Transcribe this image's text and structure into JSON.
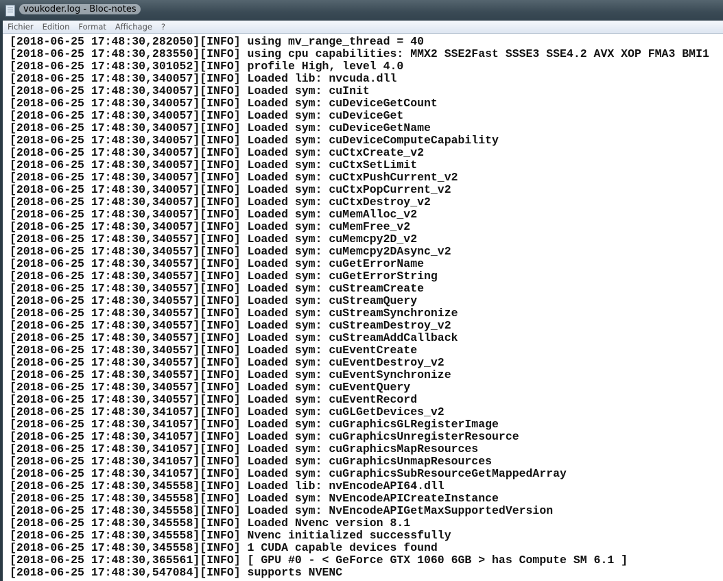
{
  "window": {
    "title": "voukoder.log - Bloc-notes"
  },
  "menu": [
    "Fichier",
    "Edition",
    "Format",
    "Affichage",
    "?"
  ],
  "lines": [
    "[2018-06-25 17:48:30,282050][INFO] using mv_range_thread = 40",
    "[2018-06-25 17:48:30,283550][INFO] using cpu capabilities: MMX2 SSE2Fast SSSE3 SSE4.2 AVX XOP FMA3 BMI1",
    "[2018-06-25 17:48:30,301052][INFO] profile High, level 4.0",
    "[2018-06-25 17:48:30,340057][INFO] Loaded lib: nvcuda.dll",
    "[2018-06-25 17:48:30,340057][INFO] Loaded sym: cuInit",
    "[2018-06-25 17:48:30,340057][INFO] Loaded sym: cuDeviceGetCount",
    "[2018-06-25 17:48:30,340057][INFO] Loaded sym: cuDeviceGet",
    "[2018-06-25 17:48:30,340057][INFO] Loaded sym: cuDeviceGetName",
    "[2018-06-25 17:48:30,340057][INFO] Loaded sym: cuDeviceComputeCapability",
    "[2018-06-25 17:48:30,340057][INFO] Loaded sym: cuCtxCreate_v2",
    "[2018-06-25 17:48:30,340057][INFO] Loaded sym: cuCtxSetLimit",
    "[2018-06-25 17:48:30,340057][INFO] Loaded sym: cuCtxPushCurrent_v2",
    "[2018-06-25 17:48:30,340057][INFO] Loaded sym: cuCtxPopCurrent_v2",
    "[2018-06-25 17:48:30,340057][INFO] Loaded sym: cuCtxDestroy_v2",
    "[2018-06-25 17:48:30,340057][INFO] Loaded sym: cuMemAlloc_v2",
    "[2018-06-25 17:48:30,340057][INFO] Loaded sym: cuMemFree_v2",
    "[2018-06-25 17:48:30,340557][INFO] Loaded sym: cuMemcpy2D_v2",
    "[2018-06-25 17:48:30,340557][INFO] Loaded sym: cuMemcpy2DAsync_v2",
    "[2018-06-25 17:48:30,340557][INFO] Loaded sym: cuGetErrorName",
    "[2018-06-25 17:48:30,340557][INFO] Loaded sym: cuGetErrorString",
    "[2018-06-25 17:48:30,340557][INFO] Loaded sym: cuStreamCreate",
    "[2018-06-25 17:48:30,340557][INFO] Loaded sym: cuStreamQuery",
    "[2018-06-25 17:48:30,340557][INFO] Loaded sym: cuStreamSynchronize",
    "[2018-06-25 17:48:30,340557][INFO] Loaded sym: cuStreamDestroy_v2",
    "[2018-06-25 17:48:30,340557][INFO] Loaded sym: cuStreamAddCallback",
    "[2018-06-25 17:48:30,340557][INFO] Loaded sym: cuEventCreate",
    "[2018-06-25 17:48:30,340557][INFO] Loaded sym: cuEventDestroy_v2",
    "[2018-06-25 17:48:30,340557][INFO] Loaded sym: cuEventSynchronize",
    "[2018-06-25 17:48:30,340557][INFO] Loaded sym: cuEventQuery",
    "[2018-06-25 17:48:30,340557][INFO] Loaded sym: cuEventRecord",
    "[2018-06-25 17:48:30,341057][INFO] Loaded sym: cuGLGetDevices_v2",
    "[2018-06-25 17:48:30,341057][INFO] Loaded sym: cuGraphicsGLRegisterImage",
    "[2018-06-25 17:48:30,341057][INFO] Loaded sym: cuGraphicsUnregisterResource",
    "[2018-06-25 17:48:30,341057][INFO] Loaded sym: cuGraphicsMapResources",
    "[2018-06-25 17:48:30,341057][INFO] Loaded sym: cuGraphicsUnmapResources",
    "[2018-06-25 17:48:30,341057][INFO] Loaded sym: cuGraphicsSubResourceGetMappedArray",
    "[2018-06-25 17:48:30,345558][INFO] Loaded lib: nvEncodeAPI64.dll",
    "[2018-06-25 17:48:30,345558][INFO] Loaded sym: NvEncodeAPICreateInstance",
    "[2018-06-25 17:48:30,345558][INFO] Loaded sym: NvEncodeAPIGetMaxSupportedVersion",
    "[2018-06-25 17:48:30,345558][INFO] Loaded Nvenc version 8.1",
    "[2018-06-25 17:48:30,345558][INFO] Nvenc initialized successfully",
    "[2018-06-25 17:48:30,345558][INFO] 1 CUDA capable devices found",
    "[2018-06-25 17:48:30,365561][INFO] [ GPU #0 - < GeForce GTX 1060 6GB > has Compute SM 6.1 ]",
    "[2018-06-25 17:48:30,547084][INFO] supports NVENC"
  ]
}
